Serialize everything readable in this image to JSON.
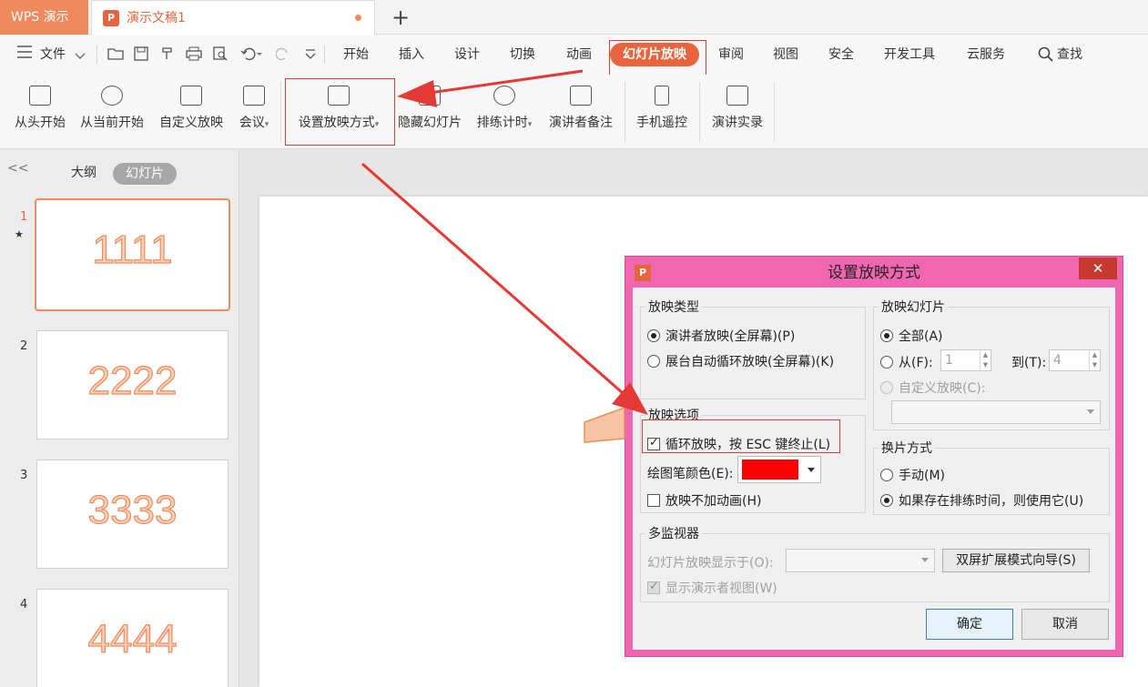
{
  "titlebar": {
    "app_tab": "WPS 演示",
    "doc_tab": "演示文稿1",
    "ppt_glyph": "P",
    "new_tab": "+"
  },
  "menubar": {
    "file": "文件",
    "tabs": [
      "开始",
      "插入",
      "设计",
      "切换",
      "动画",
      "幻灯片放映",
      "审阅",
      "视图",
      "安全",
      "开发工具",
      "云服务"
    ],
    "active_tab": "幻灯片放映",
    "search": "查找"
  },
  "ribbon": {
    "buttons": [
      "从头开始",
      "从当前开始",
      "自定义放映",
      "会议",
      "设置放映方式",
      "隐藏幻灯片",
      "排练计时",
      "演讲者备注",
      "手机遥控",
      "演讲实录"
    ]
  },
  "leftpane": {
    "collapse": "<<",
    "tab_outline": "大纲",
    "tab_slides": "幻灯片",
    "thumbs": [
      {
        "num": "1",
        "text": "1111"
      },
      {
        "num": "2",
        "text": "2222"
      },
      {
        "num": "3",
        "text": "3333"
      },
      {
        "num": "4",
        "text": "4444"
      }
    ],
    "star": "★"
  },
  "dialog": {
    "title": "设置放映方式",
    "close": "✕",
    "show_type": {
      "title": "放映类型",
      "opt1": "演讲者放映(全屏幕)(P)",
      "opt2": "展台自动循环放映(全屏幕)(K)"
    },
    "show_slides": {
      "title": "放映幻灯片",
      "all": "全部(A)",
      "from": "从(F):",
      "from_value": "1",
      "to": "到(T):",
      "to_value": "4",
      "custom": "自定义放映(C):"
    },
    "options": {
      "title": "放映选项",
      "loop": "循环放映，按 ESC 键终止(L)",
      "pen_color": "绘图笔颜色(E):",
      "pen_color_value": "#ff0000",
      "no_animation": "放映不加动画(H)"
    },
    "advance": {
      "title": "换片方式",
      "manual": "手动(M)",
      "timings": "如果存在排练时间，则使用它(U)"
    },
    "monitors": {
      "title": "多监视器",
      "display_on": "幻灯片放映显示于(O):",
      "wizard": "双屏扩展模式向导(S)",
      "presenter_view": "显示演示者视图(W)"
    },
    "ok": "确定",
    "cancel": "取消"
  },
  "colors": {
    "accent": "#e8643c",
    "dialog_frame": "#f066b0",
    "annotation_red": "#e53935"
  }
}
